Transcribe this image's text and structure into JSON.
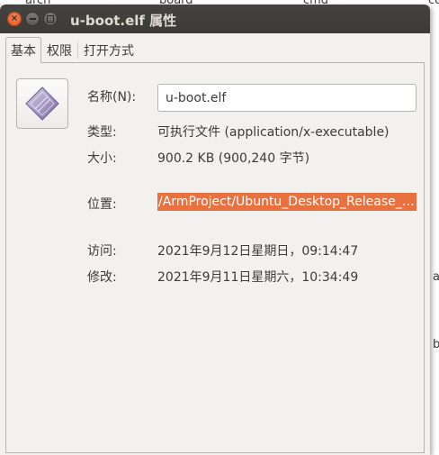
{
  "background": {
    "labels": [
      "arch",
      "board",
      "cmd",
      "co",
      "a",
      "b"
    ]
  },
  "window": {
    "title": "u-boot.elf 属性",
    "controls": {
      "close_glyph": "×",
      "close_color": "#e2511c"
    }
  },
  "tabs": [
    {
      "label": "基本",
      "active": true
    },
    {
      "label": "权限",
      "active": false
    },
    {
      "label": "打开方式",
      "active": false
    }
  ],
  "file": {
    "icon": "executable-file-icon",
    "name_label": "名称(N):",
    "name_value": "u-boot.elf",
    "type_label": "类型:",
    "type_value": "可执行文件 (application/x-executable)",
    "size_label": "大小:",
    "size_value": "900.2 KB (900,240 字节)",
    "location_label": "位置:",
    "location_value": "/ArmProject/Ubuntu_Desktop_Release_…",
    "accessed_label": "访问:",
    "accessed_value": "2021年9月12日星期日，09:14:47",
    "modified_label": "修改:",
    "modified_value": "2021年9月11日星期六，10:34:49"
  },
  "colors": {
    "selection": "#e9703f",
    "titlebar": "#3c3b37",
    "window_bg": "#f2f1f0"
  }
}
